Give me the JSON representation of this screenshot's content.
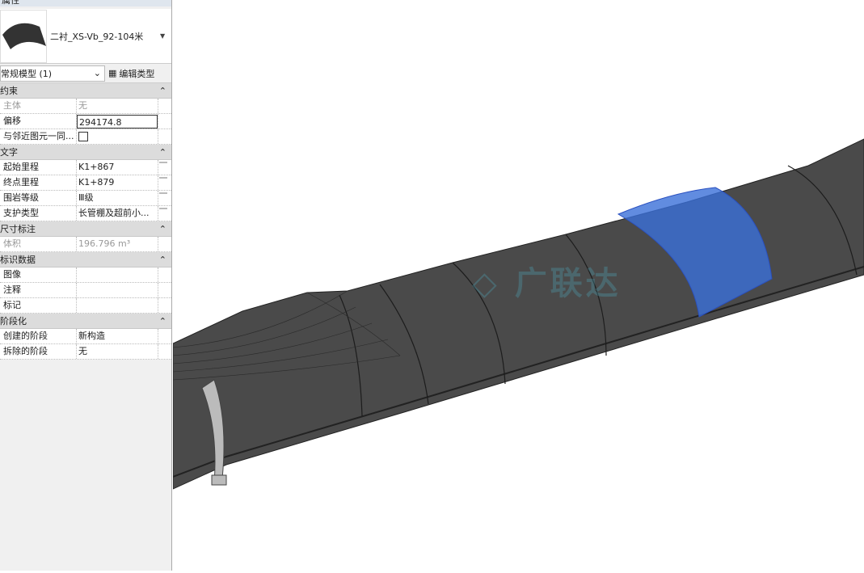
{
  "panel": {
    "title": "属性",
    "type_name": "二衬_XS-Vb_92-104米",
    "filter": "常规模型 (1)",
    "edit_type": "编辑类型"
  },
  "groups": [
    {
      "name": "约束",
      "rows": [
        {
          "k": "主体",
          "v": "无",
          "gray": true
        },
        {
          "k": "偏移",
          "v": "294174.8",
          "edit": true
        },
        {
          "k": "与邻近图元一同...",
          "checkbox": true
        }
      ]
    },
    {
      "name": "文字",
      "rows": [
        {
          "k": "起始里程",
          "v": "K1+867"
        },
        {
          "k": "终点里程",
          "v": "K1+879"
        },
        {
          "k": "围岩等级",
          "v": "Ⅲ级"
        },
        {
          "k": "支护类型",
          "v": "长管棚及超前小..."
        }
      ]
    },
    {
      "name": "尺寸标注",
      "rows": [
        {
          "k": "体积",
          "v": "196.796 m³",
          "gray": true
        }
      ]
    },
    {
      "name": "标识数据",
      "rows": [
        {
          "k": "图像",
          "v": ""
        },
        {
          "k": "注释",
          "v": ""
        },
        {
          "k": "标记",
          "v": ""
        }
      ]
    },
    {
      "name": "阶段化",
      "rows": [
        {
          "k": "创建的阶段",
          "v": "新构造"
        },
        {
          "k": "拆除的阶段",
          "v": "无"
        }
      ]
    }
  ],
  "watermark": "广联达",
  "colors": {
    "tunnel": "#4a4a4a",
    "selected": "#3a6fd8"
  }
}
